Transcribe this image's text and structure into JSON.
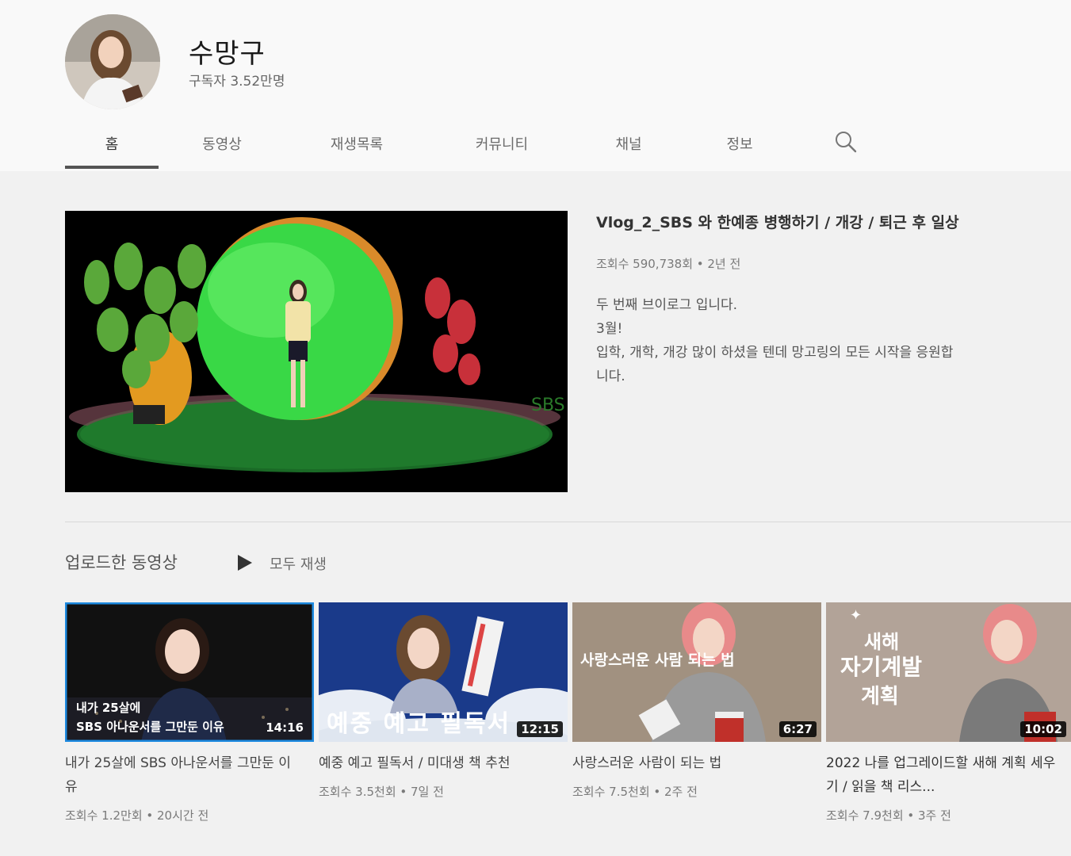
{
  "channel": {
    "name": "수망구",
    "subscribers": "구독자 3.52만명"
  },
  "tabs": [
    {
      "label": "홈"
    },
    {
      "label": "동영상"
    },
    {
      "label": "재생목록"
    },
    {
      "label": "커뮤니티"
    },
    {
      "label": "채널"
    },
    {
      "label": "정보"
    }
  ],
  "featured": {
    "title": "Vlog_2_SBS 와 한예종 병행하기 / 개강 / 퇴근 후 일상",
    "meta": "조회수 590,738회 • 2년 전",
    "description": [
      "두 번째 브이로그 입니다.",
      "3월!",
      "입학, 개학, 개강 많이 하셨을 텐데 망고링의 모든 시작을 응원합",
      "니다."
    ],
    "watermark": "SBS"
  },
  "uploads": {
    "section_title": "업로드한 동영상",
    "play_all": "모두 재생",
    "videos": [
      {
        "title": "내가 25살에 SBS 아나운서를 그만둔 이유",
        "meta": "조회수 1.2만회 • 20시간 전",
        "duration": "14:16",
        "overlay1": "내가 25살에",
        "overlay2": "SBS 아나운서를 그만둔 이유"
      },
      {
        "title": "예중 예고 필독서 / 미대생 책 추천",
        "meta": "조회수 3.5천회 • 7일 전",
        "duration": "12:15",
        "overlay1": "예중 예고 필독서"
      },
      {
        "title": "사랑스러운 사람이 되는 법",
        "meta": "조회수 7.5천회 • 2주 전",
        "duration": "6:27",
        "overlay1": "사랑스러운 사람 되는 법"
      },
      {
        "title": "2022 나를 업그레이드할 새해 계획 세우기 / 읽을 책 리스...",
        "meta": "조회수 7.9천회 • 3주 전",
        "duration": "10:02",
        "overlay1": "새해",
        "overlay2": "자기계발",
        "overlay3": "계획"
      }
    ]
  }
}
